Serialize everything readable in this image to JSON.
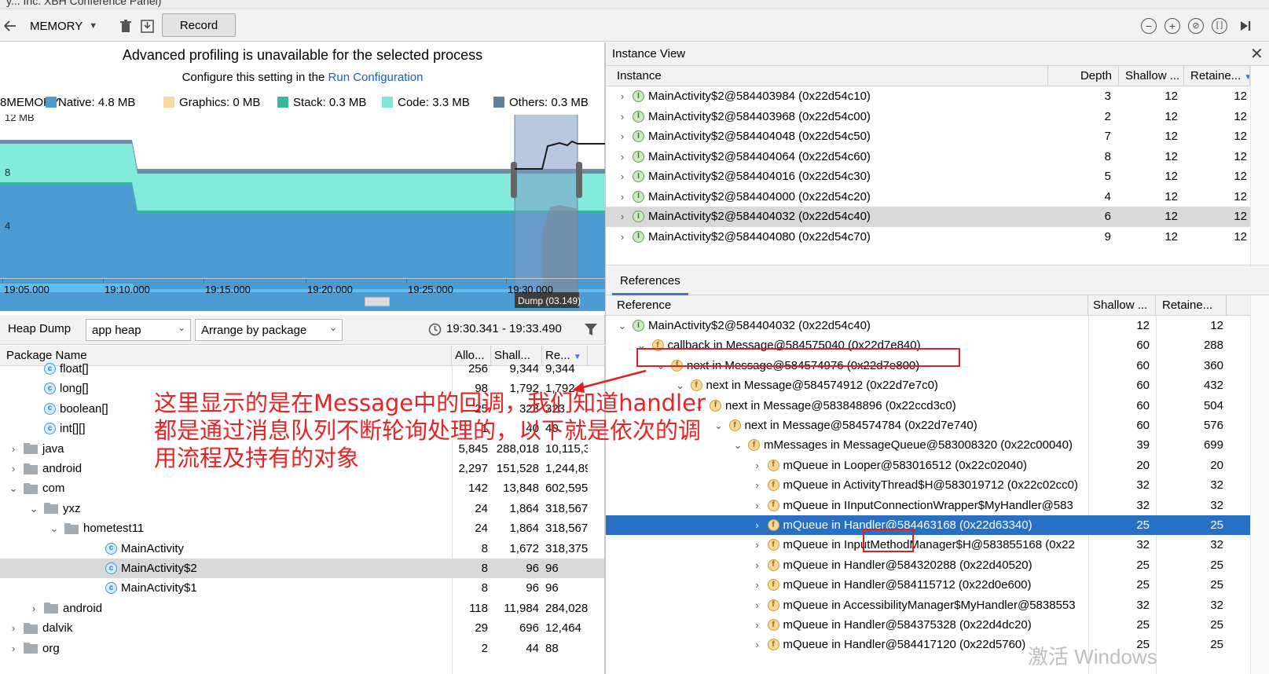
{
  "window_title": "y... Inc. XBH Conference Panel)",
  "toolbar": {
    "profiler_select": "MEMORY",
    "record_label": "Record",
    "zoom_out_icon": "minus-circle-icon",
    "zoom_in_icon": "plus-circle-icon",
    "reset_zoom_icon": "reset-icon",
    "fit_icon": "fit-icon",
    "goto_live_icon": "goto-live-icon"
  },
  "chart": {
    "warning": "Advanced profiling is unavailable for the selected process",
    "config_prefix": "Configure this setting in the",
    "config_link": "Run Configuration",
    "legend": [
      {
        "label": "8MEMORY",
        "color": "#5a9bd5"
      },
      {
        "label": "Native: 4.8 MB",
        "color": "#4f9bd0"
      },
      {
        "label": "Graphics: 0 MB",
        "color": "#f5d9a0"
      },
      {
        "label": "Stack: 0.3 MB",
        "color": "#37b89c"
      },
      {
        "label": "Code: 3.3 MB",
        "color": "#7ee8d8"
      },
      {
        "label": "Others: 0.3 MB",
        "color": "#627f99"
      }
    ],
    "y_ticks": [
      "12 MB",
      "8",
      "4"
    ],
    "x_ticks": [
      "19:05.000",
      "19:10.000",
      "19:15.000",
      "19:20.000",
      "19:25.000",
      "19:30.000"
    ],
    "dump_tooltip": "Dump (03.149)"
  },
  "heap_toolbar": {
    "title": "Heap Dump",
    "heap_select": "app heap",
    "arrange_select": "Arrange by package",
    "time_range": "19:30.341 - 19:33.490"
  },
  "package_table": {
    "columns": [
      "Package Name",
      "Allo...",
      "Shall...",
      "Re..."
    ],
    "rows": [
      {
        "name": "float[]",
        "kind": "class",
        "indent": 1,
        "chevron": "",
        "alloc": "256",
        "shallow": "9,344",
        "retained": "9,344"
      },
      {
        "name": "long[]",
        "kind": "class",
        "indent": 1,
        "chevron": "",
        "alloc": "98",
        "shallow": "1,792",
        "retained": "1,792"
      },
      {
        "name": "boolean[]",
        "kind": "class",
        "indent": 1,
        "chevron": "",
        "alloc": "25",
        "shallow": "323",
        "retained": "323"
      },
      {
        "name": "int[][]",
        "kind": "class",
        "indent": 1,
        "chevron": "",
        "alloc": "1",
        "shallow": "40",
        "retained": "40"
      },
      {
        "name": "java",
        "kind": "folder",
        "indent": 0,
        "chevron": ">",
        "alloc": "5,845",
        "shallow": "288,018",
        "retained": "10,115,3"
      },
      {
        "name": "android",
        "kind": "folder",
        "indent": 0,
        "chevron": ">",
        "alloc": "2,297",
        "shallow": "151,528",
        "retained": "1,244,89"
      },
      {
        "name": "com",
        "kind": "folder",
        "indent": 0,
        "chevron": "v",
        "alloc": "142",
        "shallow": "13,848",
        "retained": "602,595"
      },
      {
        "name": "yxz",
        "kind": "folder",
        "indent": 1,
        "chevron": "v",
        "alloc": "24",
        "shallow": "1,864",
        "retained": "318,567"
      },
      {
        "name": "hometest11",
        "kind": "folder",
        "indent": 2,
        "chevron": "v",
        "alloc": "24",
        "shallow": "1,864",
        "retained": "318,567"
      },
      {
        "name": "MainActivity",
        "kind": "class",
        "indent": 4,
        "chevron": "",
        "alloc": "8",
        "shallow": "1,672",
        "retained": "318,375"
      },
      {
        "name": "MainActivity$2",
        "kind": "class",
        "indent": 4,
        "chevron": "",
        "alloc": "8",
        "shallow": "96",
        "retained": "96",
        "selected": true
      },
      {
        "name": "MainActivity$1",
        "kind": "class",
        "indent": 4,
        "chevron": "",
        "alloc": "8",
        "shallow": "96",
        "retained": "96"
      },
      {
        "name": "android",
        "kind": "folder",
        "indent": 1,
        "chevron": ">",
        "alloc": "118",
        "shallow": "11,984",
        "retained": "284,028"
      },
      {
        "name": "dalvik",
        "kind": "folder",
        "indent": 0,
        "chevron": ">",
        "alloc": "29",
        "shallow": "696",
        "retained": "12,464"
      },
      {
        "name": "org",
        "kind": "folder",
        "indent": 0,
        "chevron": ">",
        "alloc": "2",
        "shallow": "44",
        "retained": "88"
      }
    ]
  },
  "instance_view": {
    "title": "Instance View",
    "columns": [
      "Instance",
      "Depth",
      "Shallow ...",
      "Retaine..."
    ],
    "rows": [
      {
        "name": "MainActivity$2@584403984 (0x22d54c10)",
        "depth": "3",
        "shallow": "12",
        "retained": "12"
      },
      {
        "name": "MainActivity$2@584403968 (0x22d54c00)",
        "depth": "2",
        "shallow": "12",
        "retained": "12"
      },
      {
        "name": "MainActivity$2@584404048 (0x22d54c50)",
        "depth": "7",
        "shallow": "12",
        "retained": "12"
      },
      {
        "name": "MainActivity$2@584404064 (0x22d54c60)",
        "depth": "8",
        "shallow": "12",
        "retained": "12"
      },
      {
        "name": "MainActivity$2@584404016 (0x22d54c30)",
        "depth": "5",
        "shallow": "12",
        "retained": "12"
      },
      {
        "name": "MainActivity$2@584404000 (0x22d54c20)",
        "depth": "4",
        "shallow": "12",
        "retained": "12"
      },
      {
        "name": "MainActivity$2@584404032 (0x22d54c40)",
        "depth": "6",
        "shallow": "12",
        "retained": "12",
        "selected": true
      },
      {
        "name": "MainActivity$2@584404080 (0x22d54c70)",
        "depth": "9",
        "shallow": "12",
        "retained": "12"
      }
    ]
  },
  "references": {
    "tab": "References",
    "columns": [
      "Reference",
      "Shallow ...",
      "Retaine..."
    ],
    "rows": [
      {
        "name": "MainActivity$2@584404032 (0x22d54c40)",
        "kind": "instance",
        "indent": 0,
        "chevron": "v",
        "shallow": "12",
        "retained": "12"
      },
      {
        "name": "callback in Message@584575040 (0x22d7e840)",
        "kind": "field",
        "indent": 1,
        "chevron": "v",
        "shallow": "60",
        "retained": "288"
      },
      {
        "name": "next in Message@584574976 (0x22d7e800)",
        "kind": "field",
        "indent": 2,
        "chevron": "v",
        "shallow": "60",
        "retained": "360"
      },
      {
        "name": "next in Message@584574912 (0x22d7e7c0)",
        "kind": "field",
        "indent": 3,
        "chevron": "v",
        "shallow": "60",
        "retained": "432"
      },
      {
        "name": "next in Message@583848896 (0x22ccd3c0)",
        "kind": "field",
        "indent": 4,
        "chevron": "v",
        "shallow": "60",
        "retained": "504"
      },
      {
        "name": "next in Message@584574784 (0x22d7e740)",
        "kind": "field",
        "indent": 5,
        "chevron": "v",
        "shallow": "60",
        "retained": "576"
      },
      {
        "name": "mMessages in MessageQueue@583008320 (0x22c00040)",
        "kind": "field",
        "indent": 6,
        "chevron": "v",
        "shallow": "39",
        "retained": "699"
      },
      {
        "name": "mQueue in Looper@583016512 (0x22c02040)",
        "kind": "field",
        "indent": 7,
        "chevron": ">",
        "shallow": "20",
        "retained": "20"
      },
      {
        "name": "mQueue in ActivityThread$H@583019712 (0x22c02cc0)",
        "kind": "field",
        "indent": 7,
        "chevron": ">",
        "shallow": "32",
        "retained": "32"
      },
      {
        "name": "mQueue in IInputConnectionWrapper$MyHandler@583",
        "kind": "field",
        "indent": 7,
        "chevron": ">",
        "shallow": "32",
        "retained": "32"
      },
      {
        "name": "mQueue in Handler@584463168 (0x22d63340)",
        "kind": "field",
        "indent": 7,
        "chevron": ">",
        "shallow": "25",
        "retained": "25",
        "selected": true
      },
      {
        "name": "mQueue in InputMethodManager$H@583855168 (0x22",
        "kind": "field",
        "indent": 7,
        "chevron": ">",
        "shallow": "32",
        "retained": "32"
      },
      {
        "name": "mQueue in Handler@584320288 (0x22d40520)",
        "kind": "field",
        "indent": 7,
        "chevron": ">",
        "shallow": "25",
        "retained": "25"
      },
      {
        "name": "mQueue in Handler@584115712 (0x22d0e600)",
        "kind": "field",
        "indent": 7,
        "chevron": ">",
        "shallow": "25",
        "retained": "25"
      },
      {
        "name": "mQueue in AccessibilityManager$MyHandler@5838553",
        "kind": "field",
        "indent": 7,
        "chevron": ">",
        "shallow": "32",
        "retained": "32"
      },
      {
        "name": "mQueue in Handler@584375328 (0x22d4dc20)",
        "kind": "field",
        "indent": 7,
        "chevron": ">",
        "shallow": "25",
        "retained": "25"
      },
      {
        "name": "mQueue in Handler@584417120 (0x22d5760)",
        "kind": "field",
        "indent": 7,
        "chevron": ">",
        "shallow": "25",
        "retained": "25"
      }
    ]
  },
  "annotation": {
    "lines": [
      "这里显示的是在Message中的回调，我们知道handler",
      "都是通过消息队列不断轮询处理的，以下就是依次的调",
      "用流程及持有的对象"
    ]
  },
  "watermark": "激活 Windows"
}
